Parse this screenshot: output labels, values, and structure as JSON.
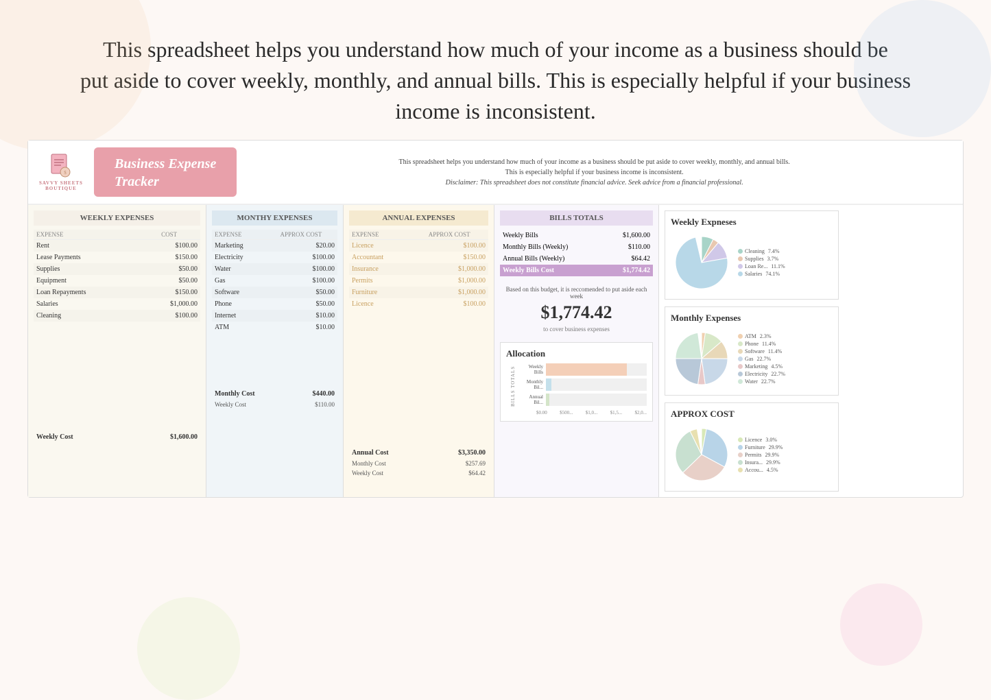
{
  "header": {
    "line1": "This spreadsheet helps you understand how much of your income as a business should be",
    "line2": "put aside to cover weekly, monthly, and annual bills. This is especially helpful if your business",
    "line3": "income is inconsistent."
  },
  "brand": {
    "name": "SAVVY SHEETS\nBOUTIQUE",
    "title": "Business Expense\nTracker"
  },
  "description": {
    "text1": "This spreadsheet helps you understand how much of your income as a business should be put aside to cover weekly, monthly, and annual bills.",
    "text2": "This is especially helpful if your business income is inconsistent.",
    "disclaimer": "Disclaimer: This spreadsheet does not constitute financial advice. Seek advice from a financial professional."
  },
  "weekly_expenses": {
    "title": "WEEKLY EXPENSES",
    "col1": "EXPENSE",
    "col2": "COST",
    "rows": [
      {
        "expense": "Rent",
        "cost": "$100.00"
      },
      {
        "expense": "Lease Payments",
        "cost": "$150.00"
      },
      {
        "expense": "Supplies",
        "cost": "$50.00"
      },
      {
        "expense": "Equipment",
        "cost": "$50.00"
      },
      {
        "expense": "Loan Repayments",
        "cost": "$150.00"
      },
      {
        "expense": "Salaries",
        "cost": "$1,000.00"
      },
      {
        "expense": "Cleaning",
        "cost": "$100.00"
      }
    ],
    "weekly_cost_label": "Weekly Cost",
    "weekly_cost_value": "$1,600.00"
  },
  "monthly_expenses": {
    "title": "MONTHY EXPENSES",
    "col1": "EXPENSE",
    "col2": "APPROX COST",
    "rows": [
      {
        "expense": "Marketing",
        "cost": "$20.00"
      },
      {
        "expense": "Electricity",
        "cost": "$100.00"
      },
      {
        "expense": "Water",
        "cost": "$100.00"
      },
      {
        "expense": "Gas",
        "cost": "$100.00"
      },
      {
        "expense": "Software",
        "cost": "$50.00"
      },
      {
        "expense": "Phone",
        "cost": "$50.00"
      },
      {
        "expense": "Internet",
        "cost": "$10.00"
      },
      {
        "expense": "ATM",
        "cost": "$10.00"
      }
    ],
    "monthly_cost_label": "Monthly Cost",
    "monthly_cost_value": "$440.00",
    "weekly_cost_label": "Weekly Cost",
    "weekly_cost_value": "$110.00"
  },
  "annual_expenses": {
    "title": "ANNUAL EXPENSES",
    "col1": "EXPENSE",
    "col2": "APPROX COST",
    "rows": [
      {
        "expense": "Licence",
        "cost": "$100.00"
      },
      {
        "expense": "Accountant",
        "cost": "$150.00"
      },
      {
        "expense": "Insurance",
        "cost": "$1,000.00"
      },
      {
        "expense": "Permits",
        "cost": "$1,000.00"
      },
      {
        "expense": "Furniture",
        "cost": "$1,000.00"
      },
      {
        "expense": "Licence",
        "cost": "$100.00"
      }
    ],
    "annual_cost_label": "Annual Cost",
    "annual_cost_value": "$3,350.00",
    "monthly_cost_label": "Monthly Cost",
    "monthly_cost_value": "$257.69",
    "weekly_cost_label": "Weekly Cost",
    "weekly_cost_value": "$64.42"
  },
  "bills_totals": {
    "title": "BILLS TOTALS",
    "rows": [
      {
        "label": "Weekly Bills",
        "value": "$1,600.00"
      },
      {
        "label": "Monthly Bills (Weekly)",
        "value": "$110.00"
      },
      {
        "label": "Annual Bills (Weekly)",
        "value": "$64.42"
      },
      {
        "label": "Weekly Bills Cost",
        "value": "$1,774.42",
        "highlight": true
      }
    ],
    "recommendation": "Based on this budget, it is reccomended to put aside each week",
    "big_amount": "$1,774.42",
    "rec_sub": "to cover business expenses"
  },
  "allocation": {
    "title": "Allocation",
    "y_label": "BILLS TOTALS",
    "bars": [
      {
        "label": "Weekly Bills",
        "value": 1600,
        "max": 2000,
        "color": "#f5c0a0"
      },
      {
        "label": "Monthly Bil...",
        "value": 110,
        "max": 2000,
        "color": "#b0d8e8"
      },
      {
        "label": "Annual Bil...",
        "value": 64,
        "max": 2000,
        "color": "#c8e0b8"
      }
    ],
    "x_labels": [
      "$0.00",
      "$500...",
      "$1,0...",
      "$1,5...",
      "$2,0..."
    ]
  },
  "weekly_chart": {
    "title": "Weekly Expneses",
    "slices": [
      {
        "label": "Cleaning",
        "pct": "7.4%",
        "color": "#a8d4c8",
        "angle_start": 0,
        "angle_end": 26.6
      },
      {
        "label": "Supplies",
        "pct": "3.7%",
        "color": "#e8c8b0",
        "angle_start": 26.6,
        "angle_end": 40
      },
      {
        "label": "Loan Re...",
        "pct": "11.1%",
        "color": "#d0c8e8",
        "angle_start": 40,
        "angle_end": 80
      },
      {
        "label": "Salaries",
        "pct": "74.1%",
        "color": "#b8d8e8",
        "angle_start": 80,
        "angle_end": 360
      }
    ]
  },
  "monthly_chart": {
    "title": "Monthly Expenses",
    "slices": [
      {
        "label": "ATM",
        "pct": "2.3%",
        "color": "#f0d0b0"
      },
      {
        "label": "Phone",
        "pct": "11.4%",
        "color": "#d8e8c8"
      },
      {
        "label": "Software",
        "pct": "11.4%",
        "color": "#e8d8b8"
      },
      {
        "label": "Gas",
        "pct": "22.7%",
        "color": "#c8d8e8"
      },
      {
        "label": "Marketing",
        "pct": "4.5%",
        "color": "#e8c8c8"
      },
      {
        "label": "Electricity",
        "pct": "22.7%",
        "color": "#b8c8d8"
      },
      {
        "label": "Water",
        "pct": "22.7%",
        "color": "#d0e8d8"
      }
    ]
  },
  "approx_chart": {
    "title": "APPROX COST",
    "slices": [
      {
        "label": "Licence",
        "pct": "3.0%",
        "color": "#d8e8b8"
      },
      {
        "label": "Furniture",
        "pct": "29.9%",
        "color": "#b8d4e8"
      },
      {
        "label": "Permits",
        "pct": "29.9%",
        "color": "#e8d0c8"
      },
      {
        "label": "Insura...",
        "pct": "29.9%",
        "color": "#c8e0d0"
      },
      {
        "label": "Accou...",
        "pct": "4.5%",
        "color": "#e8e0b0"
      }
    ]
  }
}
